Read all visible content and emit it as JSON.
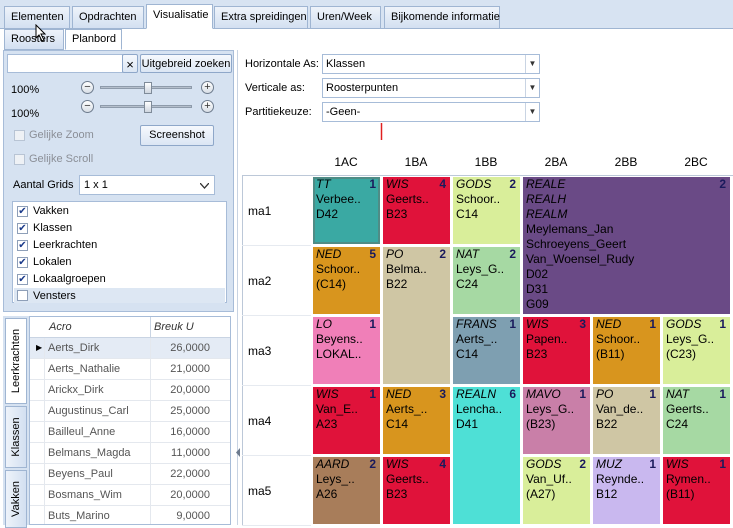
{
  "tabs": [
    "Elementen",
    "Opdrachten",
    "Visualisatie",
    "Extra spreidingen",
    "Uren/Week",
    "Bijkomende informatie"
  ],
  "subtabs": [
    "Roosters",
    "Planbord"
  ],
  "search": {
    "value": "",
    "clear": "×",
    "advanced": "Uitgebreid zoeken"
  },
  "zoom": {
    "h": "100%",
    "v": "100%",
    "minus": "−",
    "plus": "+"
  },
  "options": {
    "gelijke_zoom": "Gelijke Zoom",
    "screenshot": "Screenshot",
    "gelijke_scroll": "Gelijke Scroll",
    "aantal_grids_label": "Aantal Grids",
    "aantal_grids_value": "1 x 1"
  },
  "checklist": [
    {
      "label": "Vakken",
      "checked": true
    },
    {
      "label": "Klassen",
      "checked": true
    },
    {
      "label": "Leerkrachten",
      "checked": true
    },
    {
      "label": "Lokalen",
      "checked": true
    },
    {
      "label": "Lokaalgroepen",
      "checked": true
    },
    {
      "label": "Vensters",
      "checked": false
    }
  ],
  "vtabs": [
    "Leerkrachten",
    "Klassen",
    "Vakken"
  ],
  "teacher_grid": {
    "headers": [
      "Acro",
      "Breuk U"
    ],
    "rows": [
      [
        "Aerts_Dirk",
        "26,0000"
      ],
      [
        "Aerts_Nathalie",
        "21,0000"
      ],
      [
        "Arickx_Dirk",
        "20,0000"
      ],
      [
        "Augustinus_Carl",
        "25,0000"
      ],
      [
        "Bailleul_Anne",
        "16,0000"
      ],
      [
        "Belmans_Magda",
        "11,0000"
      ],
      [
        "Beyens_Paul",
        "22,0000"
      ],
      [
        "Bosmans_Wim",
        "20,0000"
      ],
      [
        "Buts_Marino",
        "9,0000"
      ]
    ]
  },
  "axes": {
    "h_label": "Horizontale As:",
    "h_value": "Klassen",
    "v_label": "Verticale as:",
    "v_value": "Roosterpunten",
    "p_label": "Partitiekeuze:",
    "p_value": "-Geen-"
  },
  "columns": [
    "1AC",
    "1BA",
    "1BB",
    "2BA",
    "2BB",
    "2BC"
  ],
  "rows": [
    "ma1",
    "ma2",
    "ma3",
    "ma4",
    "ma5"
  ],
  "cells": [
    {
      "c": 0,
      "r": 0,
      "h": 1,
      "color": "#3aa9a3",
      "lines": [
        "TT",
        "Verbee..",
        "D42"
      ],
      "it": [
        0
      ],
      "n": "1"
    },
    {
      "c": 1,
      "r": 0,
      "h": 1,
      "color": "#e0123a",
      "lines": [
        "WIS",
        "Geerts..",
        "B23"
      ],
      "it": [
        0
      ],
      "n": "4"
    },
    {
      "c": 2,
      "r": 0,
      "h": 1,
      "color": "#d9ee9a",
      "lines": [
        "GODS",
        "Schoor..",
        "C14"
      ],
      "it": [
        0
      ],
      "n": "2"
    },
    {
      "c": 3,
      "r": 0,
      "h": 2,
      "w": 3,
      "color": "#6a4a86",
      "lines": [
        "REALE",
        "REALH",
        "REALM",
        "Meylemans_Jan",
        "Schroeyens_Geert",
        "Van_Woensel_Rudy",
        "D02",
        "D31",
        "G09"
      ],
      "it": [
        0,
        1,
        2
      ],
      "n": "2"
    },
    {
      "c": 0,
      "r": 1,
      "h": 1,
      "color": "#d8951e",
      "lines": [
        "NED",
        "Schoor..",
        "(C14)"
      ],
      "it": [
        0
      ],
      "n": "5"
    },
    {
      "c": 1,
      "r": 1,
      "h": 2,
      "color": "#cfc6a4",
      "lines": [
        "PO",
        "Belma..",
        "B22"
      ],
      "it": [
        0
      ],
      "n": "2"
    },
    {
      "c": 2,
      "r": 1,
      "h": 1,
      "color": "#a6d9a3",
      "lines": [
        "NAT",
        "Leys_G..",
        "C24"
      ],
      "it": [
        0
      ],
      "n": "2"
    },
    {
      "c": 0,
      "r": 2,
      "h": 1,
      "color": "#f07fb8",
      "lines": [
        "LO",
        "Beyens..",
        "LOKAL.."
      ],
      "it": [
        0
      ],
      "n": "1"
    },
    {
      "c": 2,
      "r": 2,
      "h": 1,
      "color": "#7e9fb1",
      "lines": [
        "FRANS",
        "Aerts_..",
        "C14"
      ],
      "it": [
        0
      ],
      "n": "1"
    },
    {
      "c": 3,
      "r": 2,
      "h": 1,
      "color": "#e0123a",
      "lines": [
        "WIS",
        "Papen..",
        "B23"
      ],
      "it": [
        0
      ],
      "n": "3"
    },
    {
      "c": 4,
      "r": 2,
      "h": 1,
      "color": "#d8951e",
      "lines": [
        "NED",
        "Schoor..",
        "(B11)"
      ],
      "it": [
        0
      ],
      "n": "1"
    },
    {
      "c": 5,
      "r": 2,
      "h": 1,
      "color": "#d9ee9a",
      "lines": [
        "GODS",
        "Leys_G..",
        "(C23)"
      ],
      "it": [
        0
      ],
      "n": "1"
    },
    {
      "c": 0,
      "r": 3,
      "h": 1,
      "color": "#e0123a",
      "lines": [
        "WIS",
        "Van_E..",
        "A23"
      ],
      "it": [
        0
      ],
      "n": "1"
    },
    {
      "c": 1,
      "r": 3,
      "h": 1,
      "color": "#d8951e",
      "lines": [
        "NED",
        "Aerts_..",
        "C14"
      ],
      "it": [
        0
      ],
      "n": "3"
    },
    {
      "c": 2,
      "r": 3,
      "h": 2,
      "color": "#4ee0d6",
      "lines": [
        "REALN",
        "Lencha..",
        "D41"
      ],
      "it": [
        0
      ],
      "n": "6"
    },
    {
      "c": 3,
      "r": 3,
      "h": 1,
      "color": "#c97fa8",
      "lines": [
        "MAVO",
        "Leys_G..",
        "(B23)"
      ],
      "it": [
        0
      ],
      "n": "1"
    },
    {
      "c": 4,
      "r": 3,
      "h": 1,
      "color": "#cfc6a4",
      "lines": [
        "PO",
        "Van_de..",
        "B22"
      ],
      "it": [
        0
      ],
      "n": "1"
    },
    {
      "c": 5,
      "r": 3,
      "h": 1,
      "color": "#a6d9a3",
      "lines": [
        "NAT",
        "Geerts..",
        "C24"
      ],
      "it": [
        0
      ],
      "n": "1"
    },
    {
      "c": 0,
      "r": 4,
      "h": 1,
      "color": "#a87d5a",
      "lines": [
        "AARD",
        "Leys_..",
        "A26"
      ],
      "it": [
        0
      ],
      "n": "2"
    },
    {
      "c": 1,
      "r": 4,
      "h": 1,
      "color": "#e0123a",
      "lines": [
        "WIS",
        "Geerts..",
        "B23"
      ],
      "it": [
        0
      ],
      "n": "4"
    },
    {
      "c": 3,
      "r": 4,
      "h": 1,
      "color": "#d9ee9a",
      "lines": [
        "GODS",
        "Van_Uf..",
        "(A27)"
      ],
      "it": [
        0
      ],
      "n": "2"
    },
    {
      "c": 4,
      "r": 4,
      "h": 1,
      "color": "#c9b8ef",
      "lines": [
        "MUZ",
        "Reynde..",
        "B12"
      ],
      "it": [
        0
      ],
      "n": "1"
    },
    {
      "c": 5,
      "r": 4,
      "h": 1,
      "color": "#e0123a",
      "lines": [
        "WIS",
        "Rymen..",
        "(B11)"
      ],
      "it": [
        0
      ],
      "n": "1"
    }
  ]
}
